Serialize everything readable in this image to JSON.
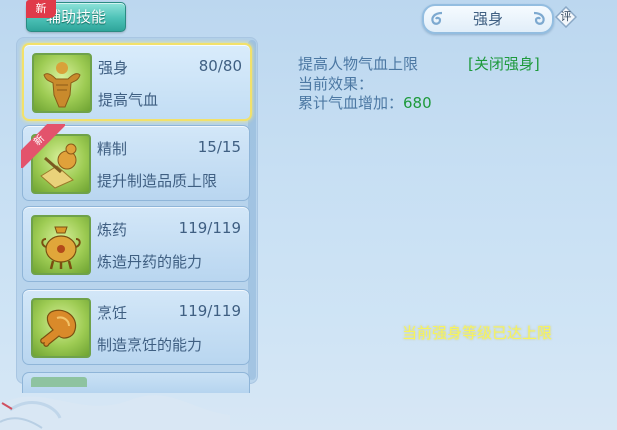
{
  "tab": {
    "label": "辅助技能",
    "badge": "新"
  },
  "title": "强身",
  "rate_label": "评",
  "skills": [
    {
      "name": "强身",
      "level": "80/80",
      "desc": "提高气血",
      "selected": true
    },
    {
      "name": "精制",
      "level": "15/15",
      "desc": "提升制造品质上限",
      "badge": "新"
    },
    {
      "name": "炼药",
      "level": "119/119",
      "desc": "炼造丹药的能力"
    },
    {
      "name": "烹饪",
      "level": "119/119",
      "desc": "制造烹饪的能力"
    }
  ],
  "detail": {
    "line1": "提高人物气血上限",
    "close_label": "[关闭强身]",
    "line2": "当前效果：",
    "line3_label": "累计气血增加：",
    "line3_value": "680",
    "max_message": "当前强身等级已达上限"
  }
}
